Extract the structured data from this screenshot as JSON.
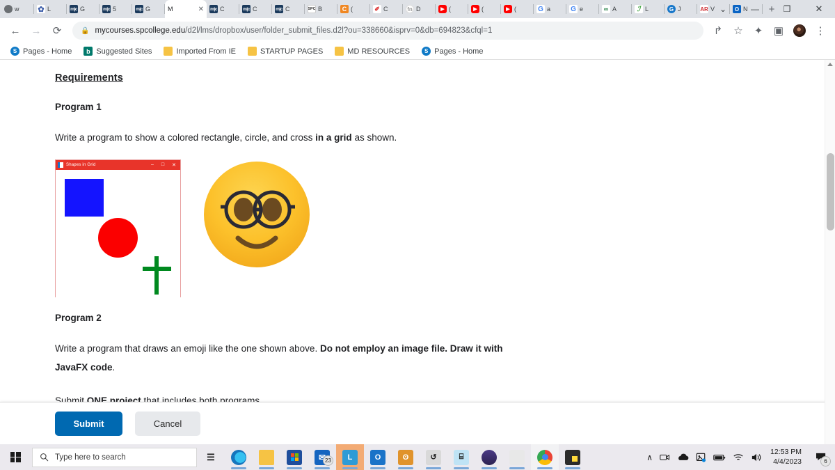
{
  "browser": {
    "tabs": [
      {
        "label": "w",
        "icon": "globe-icon",
        "icon_kind": "fv-globe",
        "active": false
      },
      {
        "label": "L",
        "icon": "flower-icon",
        "icon_kind": "fv-flower",
        "active": false
      },
      {
        "label": "G",
        "icon": "mic-icon",
        "icon_kind": "fv-mic",
        "active": false
      },
      {
        "label": "5",
        "icon": "mic-icon",
        "icon_kind": "fv-mic",
        "active": false
      },
      {
        "label": "G",
        "icon": "mic-icon",
        "icon_kind": "fv-mic",
        "active": false
      },
      {
        "label": "M",
        "icon": "blank-icon",
        "icon_kind": "fv-blank",
        "active": true
      },
      {
        "label": "C",
        "icon": "mic-icon",
        "icon_kind": "fv-mic",
        "active": false
      },
      {
        "label": "C",
        "icon": "mic-icon",
        "icon_kind": "fv-mic",
        "active": false
      },
      {
        "label": "C",
        "icon": "mic-icon",
        "icon_kind": "fv-mic",
        "active": false
      },
      {
        "label": "B",
        "icon": "spc-icon",
        "icon_kind": "fv-spc",
        "active": false
      },
      {
        "label": "(",
        "icon": "canvas-icon",
        "icon_kind": "fv-c",
        "active": false
      },
      {
        "label": "C",
        "icon": "clipboard-icon",
        "icon_kind": "fv-red",
        "active": false
      },
      {
        "label": "D",
        "icon": "function-icon",
        "icon_kind": "fv-fn",
        "active": false
      },
      {
        "label": "(",
        "icon": "youtube-icon",
        "icon_kind": "fv-yt",
        "active": false
      },
      {
        "label": "(",
        "icon": "youtube-icon",
        "icon_kind": "fv-yt",
        "active": false
      },
      {
        "label": "(",
        "icon": "youtube-icon",
        "icon_kind": "fv-yt",
        "active": false
      },
      {
        "label": "a",
        "icon": "google-icon",
        "icon_kind": "fv-g",
        "active": false
      },
      {
        "label": "e",
        "icon": "google-icon",
        "icon_kind": "fv-g",
        "active": false
      },
      {
        "label": "A",
        "icon": "aleks-icon",
        "icon_kind": "fv-ae",
        "active": false
      },
      {
        "label": "L",
        "icon": "elsevier-icon",
        "icon_kind": "fv-el",
        "active": false
      },
      {
        "label": "J",
        "icon": "globe-blue-icon",
        "icon_kind": "fv-gb",
        "active": false
      },
      {
        "label": "V",
        "icon": "acrobat-icon",
        "icon_kind": "fv-ar",
        "active": false
      },
      {
        "label": "N",
        "icon": "outlook-icon",
        "icon_kind": "fv-ol",
        "active": false
      }
    ],
    "new_tab_label": "+",
    "window_controls": {
      "minimize": "—",
      "maximize": "❐",
      "close": "✕",
      "chevron": "⌄"
    },
    "nav": {
      "back": "←",
      "forward": "→",
      "reload": "⟳"
    },
    "omnibox": {
      "lock_icon": "lock-icon",
      "url_host": "mycourses.spcollege.edu",
      "url_path": "/d2l/lms/dropbox/user/folder_submit_files.d2l?ou=338660&isprv=0&db=694823&cfql=1"
    },
    "toolbar_icons": {
      "share": "↱",
      "star": "☆",
      "extensions": "✦",
      "sidebar": "▣",
      "menu": "⋮"
    },
    "bookmarks": [
      {
        "label": "Pages - Home",
        "icon": "sharepoint-icon",
        "icon_kind": "ic-sp",
        "glyph": "S"
      },
      {
        "label": "Suggested Sites",
        "icon": "bing-icon",
        "icon_kind": "ic-b",
        "glyph": "b"
      },
      {
        "label": "Imported From IE",
        "icon": "folder-icon",
        "icon_kind": "ic-folder",
        "glyph": ""
      },
      {
        "label": "STARTUP PAGES",
        "icon": "folder-icon",
        "icon_kind": "ic-folder",
        "glyph": ""
      },
      {
        "label": "MD RESOURCES",
        "icon": "folder-icon",
        "icon_kind": "ic-folder",
        "glyph": ""
      },
      {
        "label": "Pages - Home",
        "icon": "sharepoint-icon",
        "icon_kind": "ic-sp",
        "glyph": "S"
      }
    ]
  },
  "page": {
    "requirements_heading": "Requirements",
    "program1_title": "Program 1",
    "program1_text_a": "Write a program to show a colored rectangle, circle, and cross ",
    "program1_text_bold": "in a grid",
    "program1_text_b": " as shown.",
    "program2_title": "Program 2",
    "program2_text_a": "Write a program that draws an emoji like the one shown above. ",
    "program2_text_bold": "Do not employ an image file. Draw it with JavaFX code",
    "program2_text_b": ".",
    "submit_note_a": "Submit ",
    "submit_note_bold": "ONE project",
    "submit_note_b": " that includes both programs.",
    "fx_window": {
      "title": "Shapes in Grid",
      "titlebar_color": "#e8342a",
      "minimize": "–",
      "maximize": "□",
      "close": "✕",
      "rectangle_color": "#1414ff",
      "circle_color": "#fb0000",
      "cross_color": "#00891f"
    },
    "emoji": {
      "name": "nerd-face-emoji",
      "face_color": "#fcc72d",
      "glasses_color": "#2a2a35",
      "eye_color": "#6b4a20",
      "mouth_color": "#6b4a20"
    },
    "actions": {
      "submit_label": "Submit",
      "cancel_label": "Cancel",
      "submit_color": "#0069b1"
    }
  },
  "taskbar": {
    "search_placeholder": "Type here to search",
    "search_icon": "magnifier-icon",
    "start_icon": "windows-logo-icon",
    "items": [
      {
        "name": "task-view-icon",
        "glyph": "☰",
        "color": "#1b1b1b",
        "kind": "plain"
      },
      {
        "name": "edge-icon",
        "glyph": "e",
        "color": "#1a9bd7",
        "kind": "edge"
      },
      {
        "name": "file-explorer-icon",
        "glyph": "",
        "color": "#f6c344",
        "kind": "folder"
      },
      {
        "name": "microsoft-store-icon",
        "glyph": "",
        "color": "#1f4e9c",
        "kind": "store"
      },
      {
        "name": "mail-icon",
        "glyph": "✉",
        "color": "#1565c0",
        "kind": "mail",
        "badge": "23"
      },
      {
        "name": "lockdown-browser-icon",
        "glyph": "L",
        "color": "#2e9bd6",
        "kind": "sq",
        "highlight": true
      },
      {
        "name": "cortana-icon",
        "glyph": "O",
        "color": "#1a73c8",
        "kind": "sq"
      },
      {
        "name": "amigo-icon",
        "glyph": "ʘ",
        "color": "#e0932c",
        "kind": "sq"
      },
      {
        "name": "python-icon",
        "glyph": "↺",
        "color": "#d9d9d9",
        "kind": "sq"
      },
      {
        "name": "calculator-icon",
        "glyph": "⌸",
        "color": "#bfe3f5",
        "kind": "sq"
      },
      {
        "name": "eclipse-icon",
        "glyph": "",
        "color": "#3b2a66",
        "kind": "circle"
      },
      {
        "name": "netbeans-icon",
        "glyph": "",
        "color": "#e8e8e8",
        "kind": "sq"
      },
      {
        "name": "chrome-icon",
        "glyph": "",
        "color": "#4285f4",
        "kind": "chrome",
        "active": true
      },
      {
        "name": "sticky-notes-icon",
        "glyph": "",
        "color": "#2b2b2b",
        "kind": "note"
      }
    ],
    "tray": [
      {
        "name": "chevron-up-icon",
        "glyph": "∧"
      },
      {
        "name": "camera-icon",
        "glyph": "▭"
      },
      {
        "name": "onedrive-icon",
        "glyph": "☁"
      },
      {
        "name": "photos-icon",
        "glyph": "◱"
      },
      {
        "name": "battery-icon",
        "glyph": "▬"
      },
      {
        "name": "wifi-icon",
        "glyph": "◠"
      },
      {
        "name": "volume-icon",
        "glyph": "🔊"
      }
    ],
    "clock_time": "12:53 PM",
    "clock_date": "4/4/2023",
    "notification_badge": "6"
  }
}
